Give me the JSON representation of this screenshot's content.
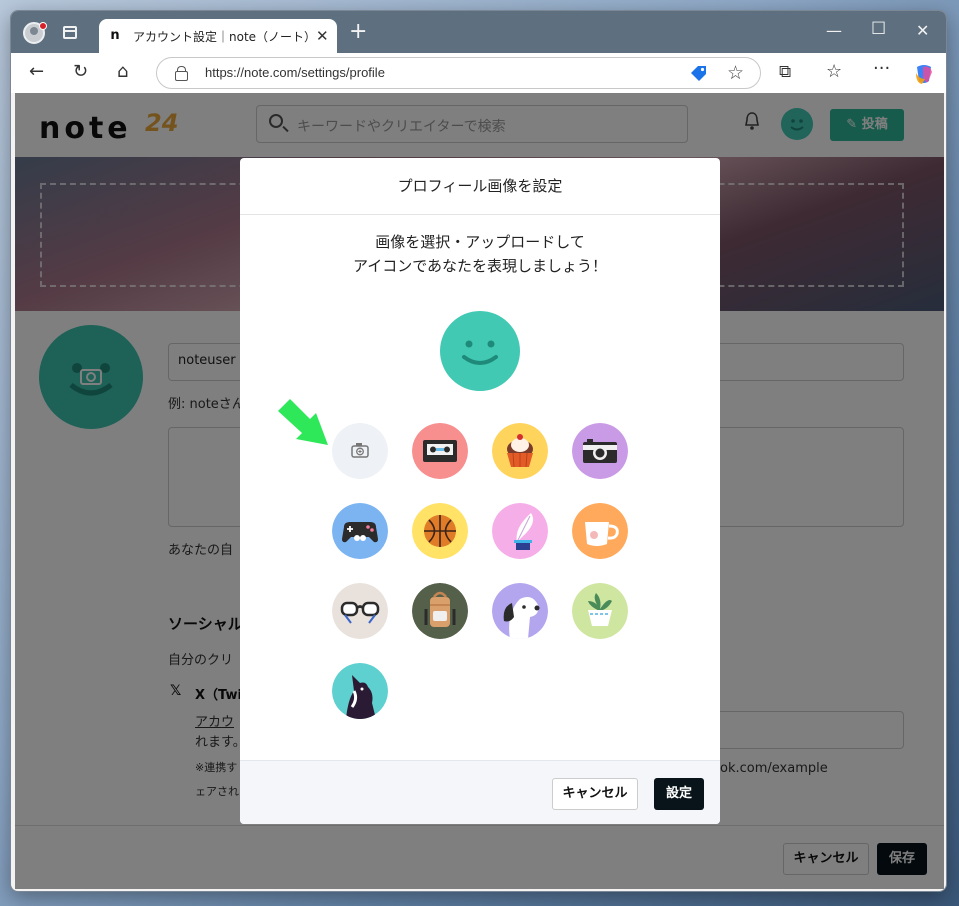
{
  "browser": {
    "tab_favicon": "n",
    "tab_title": "アカウント設定｜note（ノート）",
    "tab_close": "✕",
    "new_tab": "+",
    "url": "https://note.com/settings/profile",
    "window_controls": {
      "minimize": "—",
      "maximize": "☐",
      "close": "✕"
    },
    "nav": {
      "back": "←",
      "refresh": "↻",
      "home": "⌂",
      "star": "☆",
      "extensions": "⧉",
      "favorites": "☆",
      "more": "···"
    }
  },
  "site": {
    "logo": "note",
    "logo_suffix": "24",
    "search_placeholder": "キーワードやクリエイターで検索",
    "post_button": "投稿"
  },
  "profile_form": {
    "username_value": "noteuser",
    "username_hint": "例: noteさん",
    "bio_hint": "あなたの自",
    "social_heading": "ソーシャル",
    "social_desc": "自分のクリ",
    "x_label": "X（Twi",
    "account_link": "アカウ",
    "account_text2": "れます。",
    "note_text": "※連携す",
    "note_text2": "ェアされ",
    "url_example": "ok.com/example",
    "footer_cancel": "キャンセル",
    "footer_save": "保存"
  },
  "modal": {
    "title": "プロフィール画像を設定",
    "desc_line1": "画像を選択・アップロードして",
    "desc_line2": "アイコンであなたを表現しましょう！",
    "cancel": "キャンセル",
    "confirm": "設定",
    "icons": [
      {
        "name": "upload-camera",
        "bg": "#eef1f5"
      },
      {
        "name": "cassette-tape",
        "bg": "#f78f8f"
      },
      {
        "name": "cupcake",
        "bg": "#ffd45c"
      },
      {
        "name": "camera",
        "bg": "#c99be6"
      },
      {
        "name": "game-controller",
        "bg": "#7cb4f2"
      },
      {
        "name": "basketball",
        "bg": "#ffe266"
      },
      {
        "name": "quill-pen",
        "bg": "#f6aee8"
      },
      {
        "name": "coffee-cup",
        "bg": "#ffa95c"
      },
      {
        "name": "glasses",
        "bg": "#e9e2dc"
      },
      {
        "name": "backpack",
        "bg": "#55604a"
      },
      {
        "name": "dog",
        "bg": "#b3a6ee"
      },
      {
        "name": "plant",
        "bg": "#cfe6a1"
      },
      {
        "name": "cat",
        "bg": "#5ed0d0"
      }
    ]
  },
  "colors": {
    "brand_green": "#2cb696",
    "avatar_teal": "#41c9b4",
    "arrow": "#2ee85a"
  }
}
